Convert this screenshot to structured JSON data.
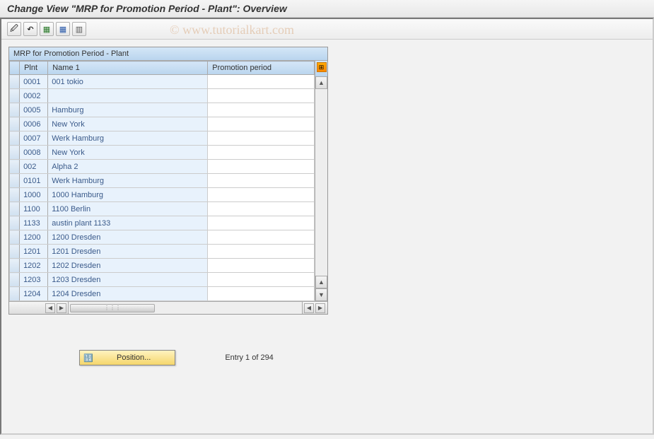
{
  "title": "Change View \"MRP for Promotion Period - Plant\": Overview",
  "watermark": "© www.tutorialkart.com",
  "toolbar": {
    "icons": [
      "pencil-icon",
      "undo-icon",
      "save-green-icon",
      "save-blue-icon",
      "delete-icon"
    ]
  },
  "table": {
    "title": "MRP for Promotion Period - Plant",
    "columns": {
      "plnt": "Plnt",
      "name": "Name 1",
      "promo": "Promotion period"
    },
    "rows": [
      {
        "plnt": "0001",
        "name": "001 tokio",
        "promo": ""
      },
      {
        "plnt": "0002",
        "name": "",
        "promo": ""
      },
      {
        "plnt": "0005",
        "name": "Hamburg",
        "promo": ""
      },
      {
        "plnt": "0006",
        "name": "New York",
        "promo": ""
      },
      {
        "plnt": "0007",
        "name": "Werk Hamburg",
        "promo": ""
      },
      {
        "plnt": "0008",
        "name": "New York",
        "promo": ""
      },
      {
        "plnt": "002",
        "name": "Alpha 2",
        "promo": ""
      },
      {
        "plnt": "0101",
        "name": "Werk Hamburg",
        "promo": ""
      },
      {
        "plnt": "1000",
        "name": "1000 Hamburg",
        "promo": ""
      },
      {
        "plnt": "1100",
        "name": "1100 Berlin",
        "promo": ""
      },
      {
        "plnt": "1133",
        "name": "austin plant 1133",
        "promo": ""
      },
      {
        "plnt": "1200",
        "name": "1200 Dresden",
        "promo": ""
      },
      {
        "plnt": "1201",
        "name": "1201 Dresden",
        "promo": ""
      },
      {
        "plnt": "1202",
        "name": "1202 Dresden",
        "promo": ""
      },
      {
        "plnt": "1203",
        "name": "1203 Dresden",
        "promo": ""
      },
      {
        "plnt": "1204",
        "name": "1204 Dresden",
        "promo": ""
      }
    ]
  },
  "footer": {
    "position_label": "Position...",
    "entry_label": "Entry 1 of 294"
  }
}
